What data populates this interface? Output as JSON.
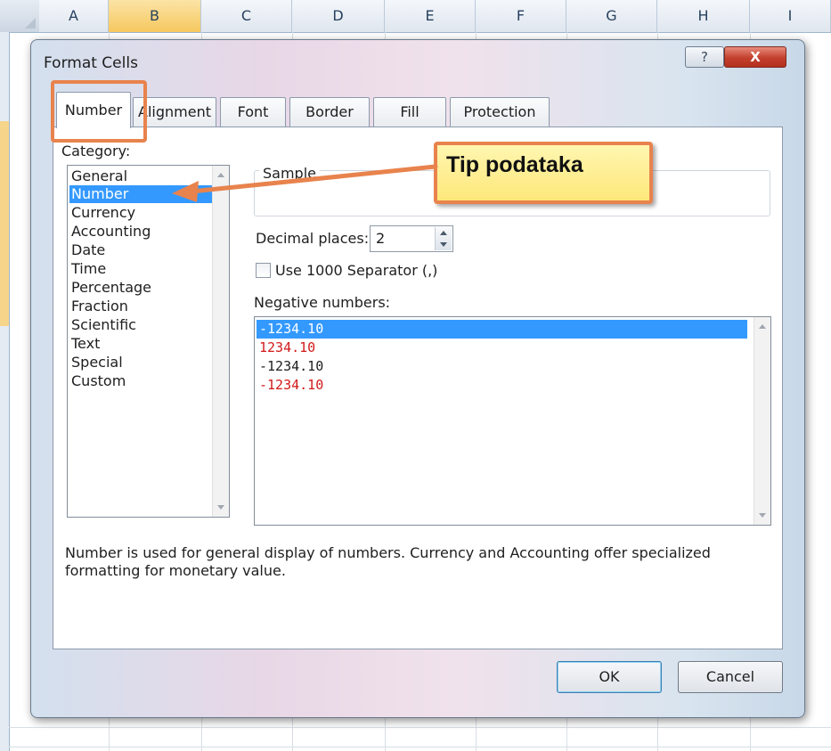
{
  "spreadsheet": {
    "columns": [
      "A",
      "B",
      "C",
      "D",
      "E",
      "F",
      "G",
      "H",
      "I"
    ],
    "selected_column": "B"
  },
  "dialog": {
    "title": "Format Cells",
    "help_glyph": "?",
    "close_glyph": "X",
    "tabs": [
      "Number",
      "Alignment",
      "Font",
      "Border",
      "Fill",
      "Protection"
    ],
    "active_tab": "Number",
    "category": {
      "label": "Category:",
      "items": [
        "General",
        "Number",
        "Currency",
        "Accounting",
        "Date",
        "Time",
        "Percentage",
        "Fraction",
        "Scientific",
        "Text",
        "Special",
        "Custom"
      ],
      "selected": "Number"
    },
    "sample_label": "Sample",
    "decimal_places": {
      "label": "Decimal places:",
      "value": "2"
    },
    "separator": {
      "label": "Use 1000 Separator (,)",
      "checked": false
    },
    "negative_numbers": {
      "label": "Negative numbers:",
      "items": [
        {
          "text": "-1234.10",
          "color": "selected"
        },
        {
          "text": "1234.10",
          "color": "red"
        },
        {
          "text": "-1234.10",
          "color": "black"
        },
        {
          "text": "-1234.10",
          "color": "red"
        }
      ]
    },
    "description": "Number is used for general display of numbers.  Currency and Accounting offer specialized formatting for monetary value.",
    "ok_label": "OK",
    "cancel_label": "Cancel"
  },
  "annotation": {
    "callout_text": "Tip podataka",
    "accent_color": "#e8834d"
  }
}
